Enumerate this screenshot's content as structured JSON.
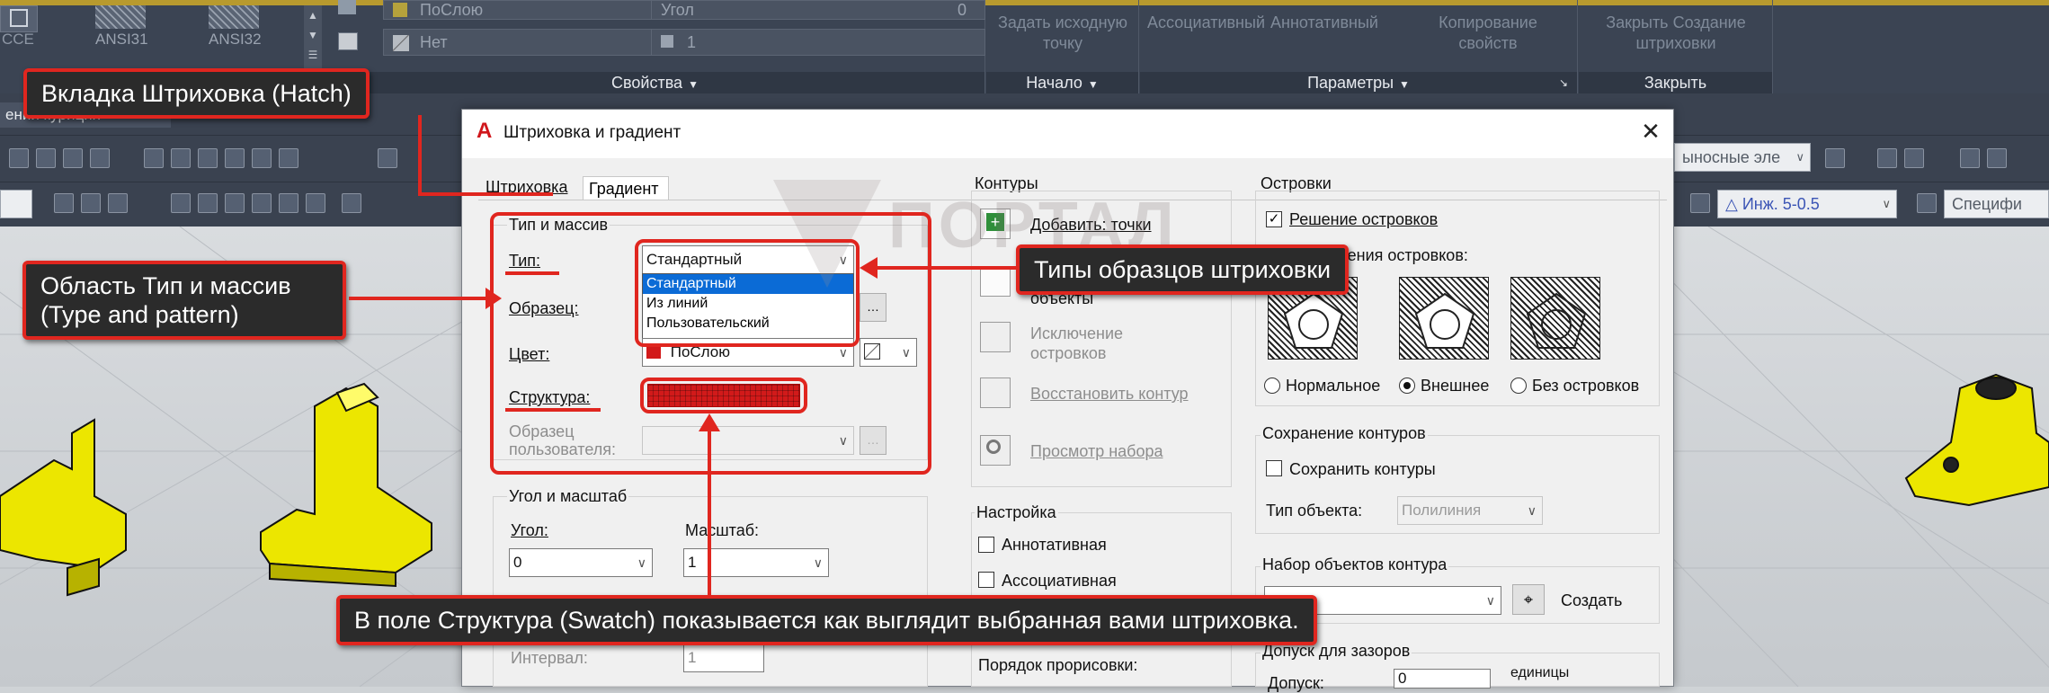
{
  "ribbon": {
    "patterns": [
      "ANSI31",
      "ANSI32"
    ],
    "first_pattern_partial": "CCE",
    "props": {
      "layer_value": "ПоСлою",
      "bg_value": "Нет",
      "angle_label": "Угол",
      "angle_value": "0",
      "scale_value": "1"
    },
    "section_properties": "Свойства",
    "origin": {
      "button": "Задать исходную точку",
      "footer": "Начало"
    },
    "options": {
      "associative": "Ассоциативный",
      "annotative": "Аннотативный",
      "copy_props": "Копирование свойств",
      "footer": "Параметры"
    },
    "close": {
      "button": "Закрыть Создание штриховки",
      "footer": "Закрыть"
    }
  },
  "tab": {
    "title": "ении курицин",
    "add": "+"
  },
  "toolbar": {
    "layer_dropdown": "ыносные эле",
    "style_value": "Инж. 5-0.5",
    "spec_value": "Специфи"
  },
  "dialog": {
    "title": "Штриховка и градиент",
    "tabs": [
      "Штриховка",
      "Градиент"
    ],
    "type_group": {
      "title": "Тип и массив",
      "type_label": "Тип:",
      "type_value": "Стандартный",
      "type_options": [
        "Стандартный",
        "Из линий",
        "Пользовательский"
      ],
      "pattern_label": "Образец:",
      "color_label": "Цвет:",
      "color_value": "ПоСлою",
      "swatch_label": "Структура:",
      "custom_label": "Образец пользователя:"
    },
    "angle_group": {
      "title": "Угол и масштаб",
      "angle_label": "Угол:",
      "angle_value": "0",
      "scale_label": "Масштаб:",
      "scale_value": "1",
      "spacing_label": "Интервал:",
      "spacing_value": "1"
    },
    "boundaries": {
      "title": "Контуры",
      "add_points": "Добавить: точки",
      "add_objects": "объекты",
      "remove_islands": "Исключение островков",
      "recreate": "Восстановить контур",
      "view": "Просмотр набора"
    },
    "options": {
      "title": "Настройка",
      "annotative": "Аннотативная",
      "associative": "Ассоциативная",
      "draw_order": "Порядок прорисовки:"
    },
    "islands": {
      "title": "Островки",
      "detect": "Решение островков",
      "style_title": "Стиль решения островков:",
      "normal": "Нормальное",
      "outer": "Внешнее",
      "ignore": "Без островков"
    },
    "retain": {
      "title": "Сохранение контуров",
      "keep": "Сохранить контуры",
      "type_label": "Тип объекта:",
      "type_value": "Полилиния"
    },
    "boundary_set": {
      "title": "Набор объектов контура",
      "create": "Создать"
    },
    "gap": {
      "title": "Допуск для зазоров",
      "label": "Допуск:",
      "value": "0",
      "units": "единицы"
    }
  },
  "annotations": {
    "hatch_tab": "Вкладка Штриховка (Hatch)",
    "type_area": "Область Тип и массив (Type and pattern)",
    "pattern_types": "Типы образцов штриховки",
    "swatch_note": "В поле Структура (Swatch) показывается как выглядит выбранная вами штриховка."
  },
  "watermark": "ПОРТАЛ",
  "colors": {
    "callout_border": "#e0261f",
    "ribbon": "#3b4453",
    "selected": "#0b6bd6",
    "swatch": "#d21a1a",
    "model_parts": "#e8e200"
  }
}
